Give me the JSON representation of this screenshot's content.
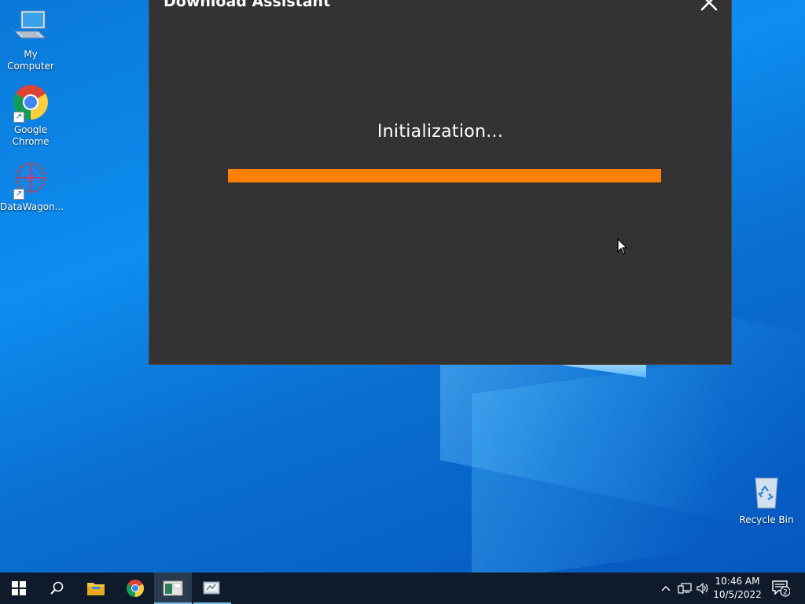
{
  "desktop": {
    "icons": [
      {
        "label": "My Computer"
      },
      {
        "label": "Google Chrome"
      },
      {
        "label": "DataWagon..."
      },
      {
        "label": "Recycle Bin"
      }
    ]
  },
  "dialog": {
    "title": "Download Assistant",
    "status": "Initialization...",
    "progress_percent": 100,
    "accent_color": "#ff8000",
    "background_color": "#333333",
    "close_icon": "close-icon"
  },
  "taskbar": {
    "buttons": [
      "start-icon",
      "search-icon",
      "file-explorer-icon",
      "chrome-icon",
      "app-window-icon",
      "download-assistant-icon"
    ],
    "tray_icons": [
      "chevron-up-icon",
      "network-icon",
      "volume-icon",
      "notifications-icon"
    ],
    "time": "10:46 AM",
    "date": "10/5/2022",
    "notification_count": "2"
  }
}
